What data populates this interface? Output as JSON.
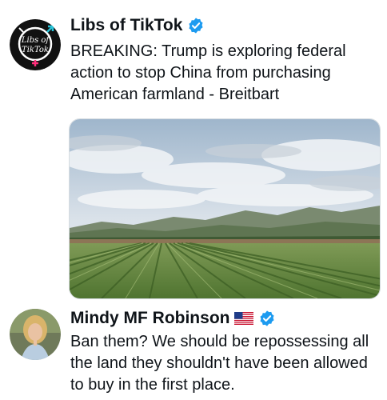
{
  "posts": [
    {
      "author": "Libs of TikTok",
      "avatar_text": [
        "Libs of",
        "TikTok"
      ],
      "verified": true,
      "text": "BREAKING: Trump is exploring federal action to stop China from purchasing American farmland - Breitbart",
      "media": {
        "subject": "farmland-with-crop-rows-and-hills"
      }
    },
    {
      "author": "Mindy MF Robinson",
      "flag_icon": "us-flag-icon",
      "verified": true,
      "text": "Ban them? We should be repossessing all the land they shouldn't have been allowed to buy in the first place."
    }
  ],
  "colors": {
    "verified_blue": "#1d9bf0",
    "text": "#0f1419",
    "avatar_bg": "#111111",
    "logo_pink": "#ff2e7a",
    "logo_cyan": "#28c4d9"
  }
}
